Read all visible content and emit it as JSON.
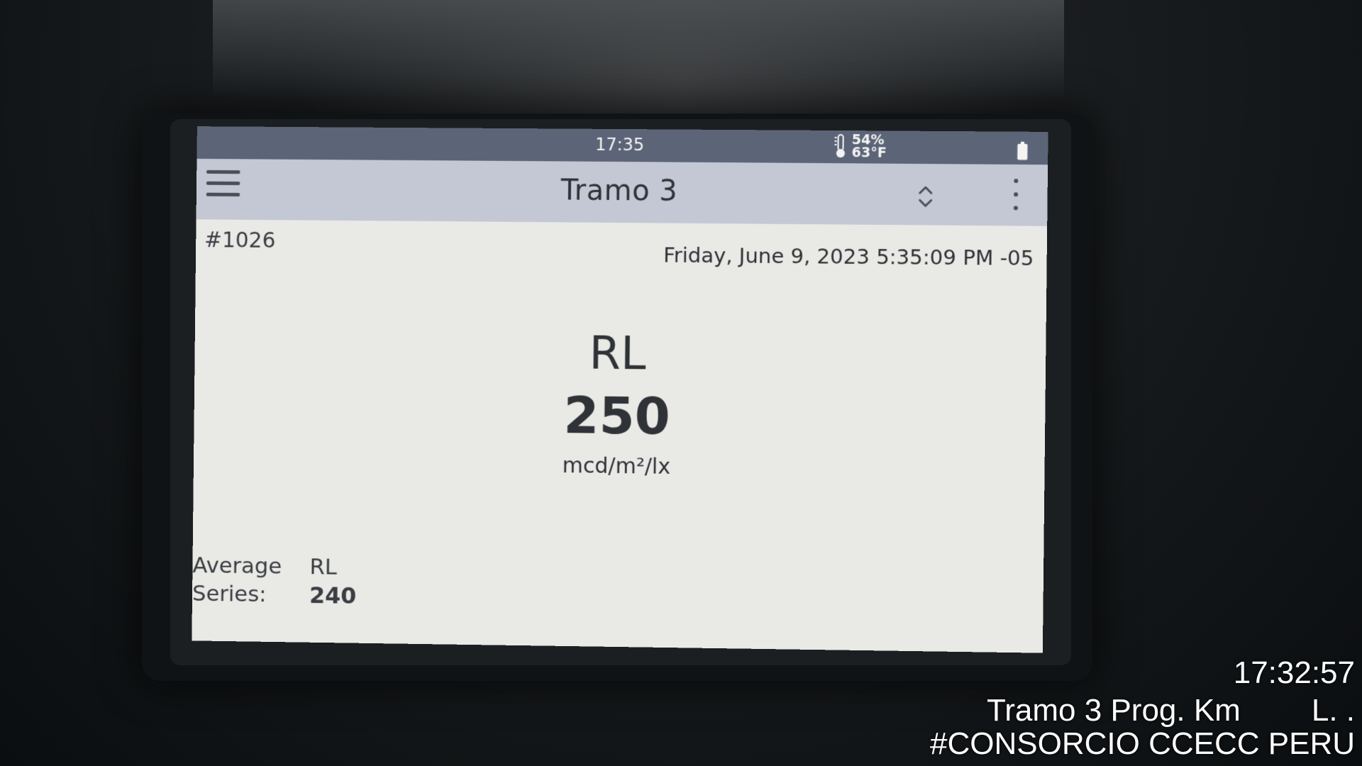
{
  "status_bar": {
    "time": "17:35",
    "humidity": "54%",
    "temperature": "63°F"
  },
  "app_bar": {
    "title": "Tramo 3"
  },
  "record": {
    "id": "#1026",
    "timestamp": "Friday, June 9, 2023 5:35:09 PM -05"
  },
  "measurement": {
    "label": "RL",
    "value": "250",
    "unit": "mcd/m²/lx"
  },
  "average": {
    "label_line1": "Average",
    "label_line2": "Series:",
    "metric": "RL",
    "value": "240"
  },
  "camera_overlay": {
    "time": "17:32:57",
    "location": "Tramo 3 Prog. Km",
    "location_suffix": "L.   .",
    "organization": "#CONSORCIO CCECC PERU"
  },
  "colors": {
    "status_bar_bg": "#5c6577",
    "app_bar_bg": "#c4c8d5",
    "screen_bg": "#e9e9e6",
    "text_dark": "#2f3236"
  },
  "icons": [
    "menu-icon",
    "thermometer-icon",
    "battery-icon",
    "sort-icon",
    "more-vert-icon"
  ]
}
